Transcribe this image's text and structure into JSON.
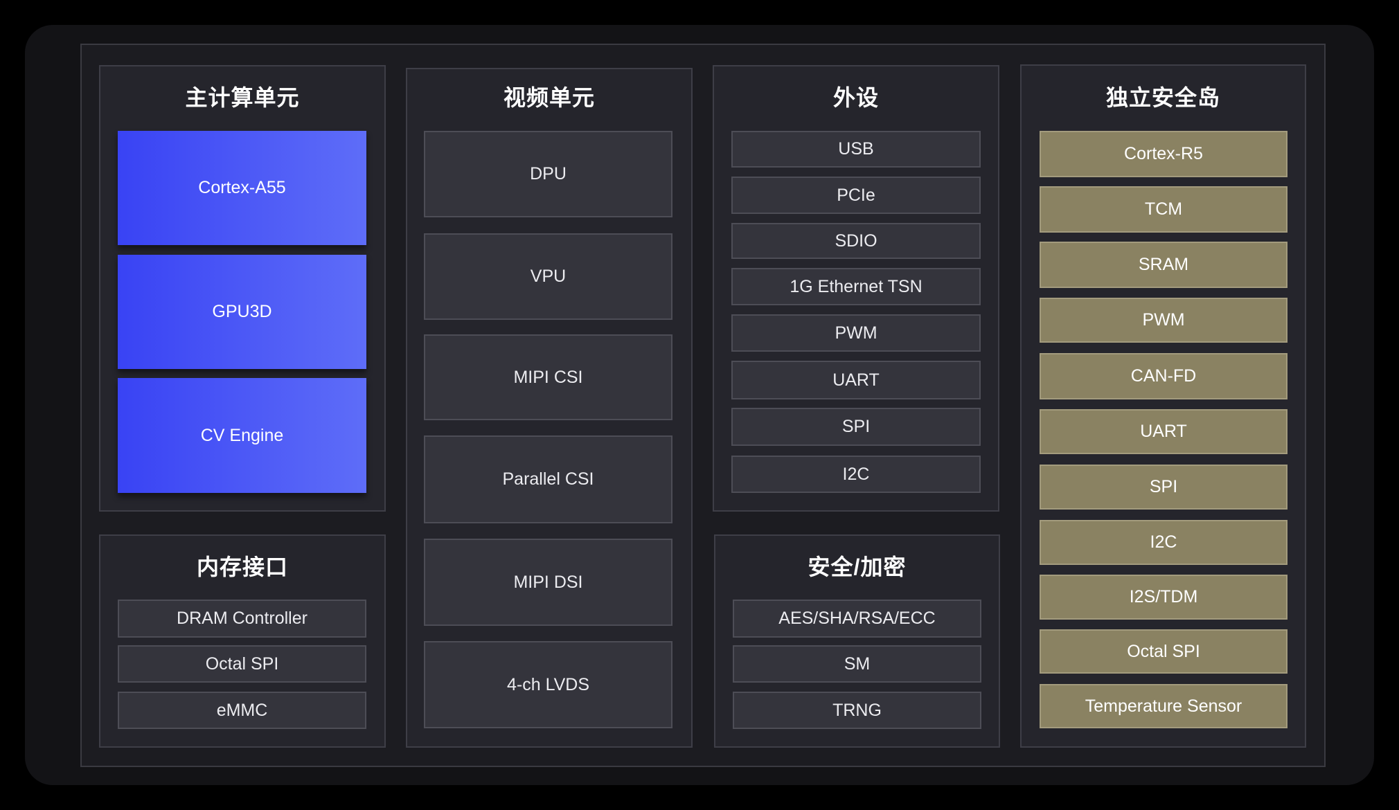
{
  "groups": {
    "main_compute": {
      "title": "主计算单元",
      "items": [
        "Cortex-A55",
        "GPU3D",
        "CV Engine"
      ]
    },
    "memory_interface": {
      "title": "内存接口",
      "items": [
        "DRAM Controller",
        "Octal SPI",
        "eMMC"
      ]
    },
    "video_unit": {
      "title": "视频单元",
      "items": [
        "DPU",
        "VPU",
        "MIPI CSI",
        "Parallel CSI",
        "MIPI DSI",
        "4-ch LVDS"
      ]
    },
    "peripherals": {
      "title": "外设",
      "items": [
        "USB",
        "PCIe",
        "SDIO",
        "1G Ethernet TSN",
        "PWM",
        "UART",
        "SPI",
        "I2C"
      ]
    },
    "security_crypto": {
      "title": "安全/加密",
      "items": [
        "AES/SHA/RSA/ECC",
        "SM",
        "TRNG"
      ]
    },
    "safety_island": {
      "title": "独立安全岛",
      "items": [
        "Cortex-R5",
        "TCM",
        "SRAM",
        "PWM",
        "CAN-FD",
        "UART",
        "SPI",
        "I2C",
        "I2S/TDM",
        "Octal SPI",
        "Temperature Sensor"
      ]
    }
  },
  "colors": {
    "page-bg": "#000000",
    "frame-bg": "#131316",
    "panel-bg": "#1c1c21",
    "group-bg": "#25252c",
    "block-bg": "#34343c",
    "blue-start": "#3943f4",
    "blue-end": "#5e6df8",
    "tan-bg": "#8a8262"
  }
}
